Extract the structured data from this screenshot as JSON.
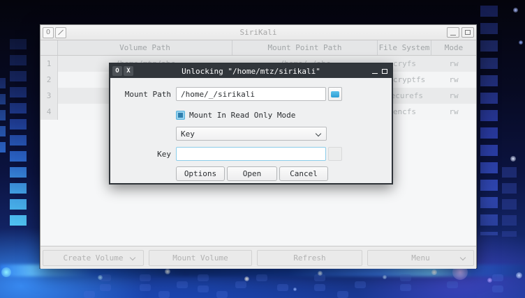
{
  "main_window": {
    "title": "SiriKali",
    "window_menu_icon": "O",
    "table": {
      "columns": [
        "Volume Path",
        "Mount Point Path",
        "File System",
        "Mode"
      ],
      "rows": [
        {
          "num": "1",
          "volume_path": "/home/mtz/abc",
          "mount_point_path": "/home/_/abc",
          "file_system": "cryfs",
          "mode": "rw"
        },
        {
          "num": "2",
          "volume_path": "",
          "mount_point_path": "",
          "file_system": "gocryptfs",
          "mode": "rw"
        },
        {
          "num": "3",
          "volume_path": "",
          "mount_point_path": "",
          "file_system": "securefs",
          "mode": "rw"
        },
        {
          "num": "4",
          "volume_path": "",
          "mount_point_path": "",
          "file_system": "encfs",
          "mode": "rw"
        }
      ]
    },
    "footer_buttons": [
      {
        "label": "Create Volume",
        "has_dropdown": true
      },
      {
        "label": "Mount Volume",
        "has_dropdown": false
      },
      {
        "label": "Refresh",
        "has_dropdown": false
      },
      {
        "label": "Menu",
        "has_dropdown": true
      }
    ]
  },
  "dialog": {
    "title": "Unlocking \"/home/mtz/sirikali\"",
    "circle_button_icon": "O",
    "close_button_icon": "X",
    "fields": {
      "mount_path_label": "Mount Path",
      "mount_path_value": "/home/_/sirikali",
      "read_only_checkbox_label": "Mount In Read Only Mode",
      "read_only_checked": true,
      "key_type_selected": "Key",
      "key_label": "Key",
      "key_value": ""
    },
    "buttons": [
      {
        "label": "Options"
      },
      {
        "label": "Open"
      },
      {
        "label": "Cancel"
      }
    ]
  },
  "colors": {
    "accent_blue": "#3daee2",
    "dialog_titlebar": "#31363b",
    "disabled_text": "#b4b8ba"
  }
}
